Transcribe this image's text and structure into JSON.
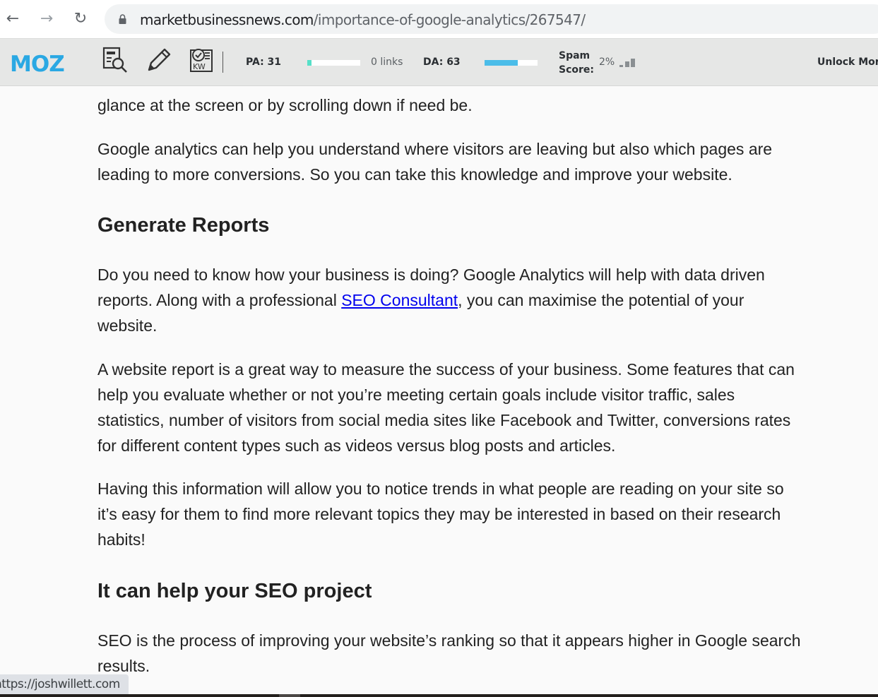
{
  "browser": {
    "back_icon": "arrow-left-icon",
    "forward_icon": "arrow-right-icon",
    "reload_icon": "reload-icon",
    "lock_icon": "lock-icon",
    "url_host": "marketbusinessnews.com",
    "url_path": "/importance-of-google-analytics/267547/"
  },
  "moz_bar": {
    "logo": "MOZ",
    "tools": [
      "page-analysis-icon",
      "highlight-pencil-icon",
      "keyword-check-icon"
    ],
    "pa_label": "PA: 31",
    "pa_value": 31,
    "links_label": "0 links",
    "da_label": "DA: 63",
    "da_value": 63,
    "spam_label_line1": "Spam",
    "spam_label_line2": "Score:",
    "spam_value": "2%",
    "unlock_label": "Unlock Mor",
    "colors": {
      "logo": "#2aa8e3",
      "pa_fill": "#56e0c8",
      "da_fill": "#4bbde9",
      "spam_bars": "#8a8f92"
    }
  },
  "article": {
    "p0": "glance at the screen or by scrolling down if need be.",
    "p1_l1": "Google analytics can help you understand where visitors are leaving but also which pages are",
    "p1_l2": "leading to more conversions. So you can take this knowledge and improve your website.",
    "h_generate": "Generate Reports",
    "p2_l1": "Do you need to know how your business is doing? Google Analytics will help with data driven",
    "p2_l2_pre": "reports. Along with a professional ",
    "p2_link": "SEO Consultant",
    "p2_l2_post": ", you can maximise the potential of your",
    "p2_l3": "website.",
    "p3_l1": "A website report is a great way to measure the success of your business. Some features that can",
    "p3_l2": "help you evaluate whether or not you’re meeting certain goals include visitor traffic, sales",
    "p3_l3": "statistics, number of visitors from social media sites like Facebook and Twitter, conversions rates",
    "p3_l4": "for different content types such as videos versus blog posts and articles.",
    "p4_l1": "Having this information will allow you to notice trends in what people are reading on your site so",
    "p4_l2": "it’s easy for them to find more relevant topics they may be interested in based on their research",
    "p4_l3": "habits!",
    "h_seo": "It can help your SEO project",
    "p5_l1": "SEO is the process of improving your website’s ranking so that it appears higher in Google search",
    "p5_l2": "results."
  },
  "status_bar": {
    "hover_url": "https://joshwillett.com"
  }
}
